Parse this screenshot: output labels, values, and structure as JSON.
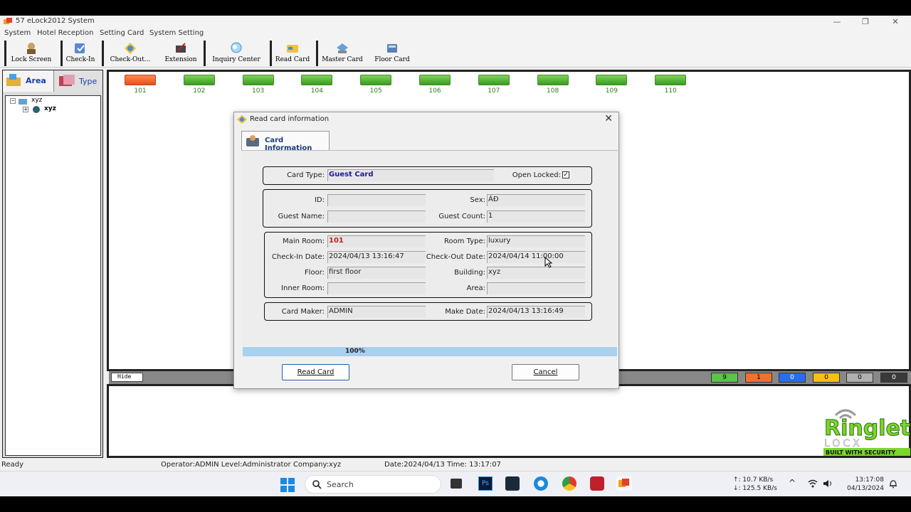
{
  "window": {
    "title": "57 eLock2012 System"
  },
  "menu": [
    "System",
    "Hotel Reception",
    "Setting Card",
    "System Setting"
  ],
  "toolbar": [
    {
      "label": "Lock Screen",
      "icon": "lock-screen-icon"
    },
    {
      "label": "Check-In",
      "icon": "check-in-icon"
    },
    {
      "label": "Check-Out...",
      "icon": "check-out-icon"
    },
    {
      "label": "Extension",
      "icon": "extension-icon"
    },
    {
      "label": "Inquiry Center",
      "icon": "inquiry-icon"
    },
    {
      "label": "Read Card",
      "icon": "read-card-icon"
    },
    {
      "label": "Master Card",
      "icon": "master-card-icon"
    },
    {
      "label": "Floor Card",
      "icon": "floor-card-icon"
    }
  ],
  "left_panel": {
    "tabs": [
      "Area",
      "Type"
    ],
    "tree": [
      "xyz",
      "xyz"
    ]
  },
  "rooms": [
    {
      "number": "101",
      "status": "occupied"
    },
    {
      "number": "102",
      "status": "vacant"
    },
    {
      "number": "103",
      "status": "vacant"
    },
    {
      "number": "104",
      "status": "vacant"
    },
    {
      "number": "105",
      "status": "vacant"
    },
    {
      "number": "106",
      "status": "vacant"
    },
    {
      "number": "107",
      "status": "vacant"
    },
    {
      "number": "108",
      "status": "vacant"
    },
    {
      "number": "109",
      "status": "vacant"
    },
    {
      "number": "110",
      "status": "vacant"
    }
  ],
  "mid_bar": {
    "hide_label": "Hide",
    "counters": [
      {
        "value": "9",
        "color": "#5cc24a"
      },
      {
        "value": "1",
        "color": "#f2702c"
      },
      {
        "value": "0",
        "color": "#2a6cf0"
      },
      {
        "value": "0",
        "color": "#f5c013"
      },
      {
        "value": "0",
        "color": "#b0b0b0"
      },
      {
        "value": "0",
        "color": "#3a3a3a"
      }
    ]
  },
  "dialog": {
    "title": "Read card information",
    "tab": "Card Information",
    "card_type_label": "Card Type:",
    "card_type": "Guest Card",
    "open_locked_label": "Open Locked:",
    "open_locked_checked": true,
    "id_label": "ID:",
    "id": "",
    "sex_label": "Sex:",
    "sex": "ÁĐ",
    "guest_name_label": "Guest Name:",
    "guest_name": "",
    "guest_count_label": "Guest Count:",
    "guest_count": "1",
    "main_room_label": "Main Room:",
    "main_room": "101",
    "room_type_label": "Room Type:",
    "room_type": "luxury",
    "checkin_label": "Check-In Date:",
    "checkin": "2024/04/13 13:16:47",
    "checkout_label": "Check-Out Date:",
    "checkout": "2024/04/14 11:00:00",
    "floor_label": "Floor:",
    "floor": "first floor",
    "building_label": "Building:",
    "building": "xyz",
    "inner_room_label": "Inner Room:",
    "inner_room": "",
    "area_label": "Area:",
    "area": "",
    "card_maker_label": "Card Maker:",
    "card_maker": "ADMIN",
    "make_date_label": "Make Date:",
    "make_date": "2024/04/13 13:16:49",
    "progress": "100%",
    "progress_value": 1.0,
    "read_button": "Read Card",
    "cancel_button": "Cancel"
  },
  "status_bar": {
    "state": "Ready",
    "operator": "Operator:ADMIN Level:Administrator Company:xyz",
    "datetime": "Date:2024/04/13 Time: 13:17:07"
  },
  "watermark": {
    "brand": "Ringlet",
    "sub": "LOCX",
    "tagline": "BUILT WITH SECURITY"
  },
  "taskbar": {
    "search_placeholder": "Search",
    "net_up": "↑: 10.7 KB/s",
    "net_down": "↓: 125.5 KB/s",
    "time": "13:17:08",
    "date": "04/13/2024"
  }
}
